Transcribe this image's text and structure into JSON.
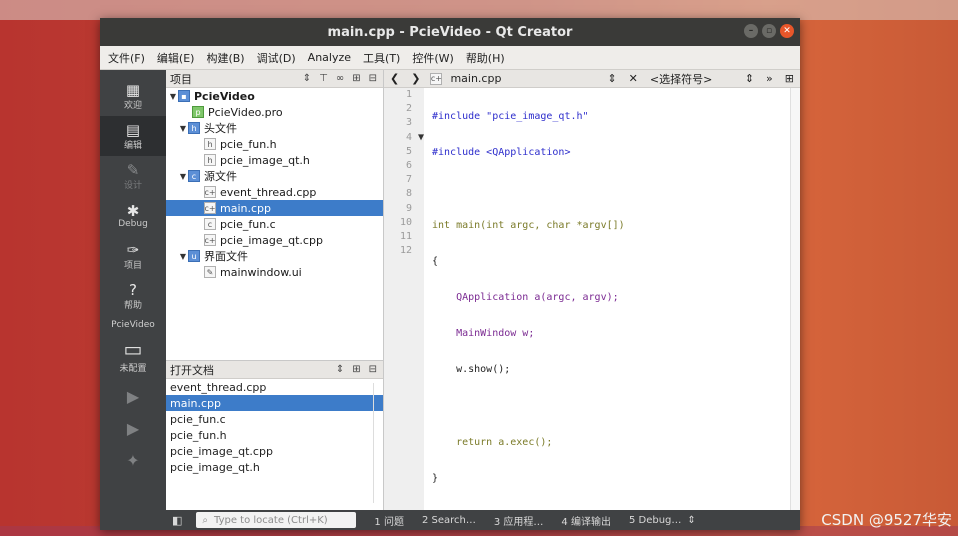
{
  "window": {
    "title": "main.cpp - PcieVideo - Qt Creator"
  },
  "menu": [
    "文件(F)",
    "编辑(E)",
    "构建(B)",
    "调试(D)",
    "Analyze",
    "工具(T)",
    "控件(W)",
    "帮助(H)"
  ],
  "modes": [
    {
      "label": "欢迎",
      "icon": "welcome-grid-icon"
    },
    {
      "label": "编辑",
      "icon": "edit-doc-icon"
    },
    {
      "label": "设计",
      "icon": "design-pencil-icon"
    },
    {
      "label": "Debug",
      "icon": "bug-icon"
    },
    {
      "label": "项目",
      "icon": "wrench-icon"
    },
    {
      "label": "帮助",
      "icon": "help-icon"
    }
  ],
  "kit": {
    "project": "PcieVideo",
    "label": "未配置"
  },
  "project_panel": {
    "title": "项目",
    "tree": [
      {
        "name": "PcieVideo",
        "level": 0,
        "type": "project"
      },
      {
        "name": "PcieVideo.pro",
        "level": 1,
        "type": "pro"
      },
      {
        "name": "头文件",
        "level": 1,
        "type": "folder"
      },
      {
        "name": "pcie_fun.h",
        "level": 2,
        "type": "h"
      },
      {
        "name": "pcie_image_qt.h",
        "level": 2,
        "type": "h"
      },
      {
        "name": "源文件",
        "level": 1,
        "type": "folder"
      },
      {
        "name": "event_thread.cpp",
        "level": 2,
        "type": "cpp"
      },
      {
        "name": "main.cpp",
        "level": 2,
        "type": "cpp",
        "selected": true
      },
      {
        "name": "pcie_fun.c",
        "level": 2,
        "type": "c"
      },
      {
        "name": "pcie_image_qt.cpp",
        "level": 2,
        "type": "cpp"
      },
      {
        "name": "界面文件",
        "level": 1,
        "type": "folder"
      },
      {
        "name": "mainwindow.ui",
        "level": 2,
        "type": "ui"
      }
    ]
  },
  "open_docs": {
    "title": "打开文档",
    "items": [
      "event_thread.cpp",
      "main.cpp",
      "pcie_fun.c",
      "pcie_fun.h",
      "pcie_image_qt.cpp",
      "pcie_image_qt.h"
    ],
    "selected": "main.cpp"
  },
  "editor": {
    "file": "main.cpp",
    "symbol": "<选择符号>",
    "lines": [
      "#include \"pcie_image_qt.h\"",
      "#include <QApplication>",
      "",
      "int main(int argc, char *argv[])",
      "{",
      "    QApplication a(argc, argv);",
      "    MainWindow w;",
      "    w.show();",
      "",
      "    return a.exec();",
      "}",
      ""
    ]
  },
  "status": {
    "locate_placeholder": "Type to locate (Ctrl+K)",
    "panes": [
      "1 问题",
      "2 Search…",
      "3 应用程…",
      "4 编译输出",
      "5 Debug…"
    ]
  },
  "watermark": "CSDN @9527华安"
}
